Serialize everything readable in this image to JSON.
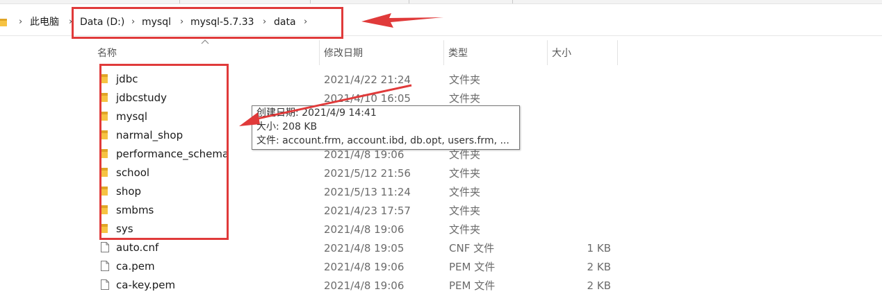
{
  "breadcrumb": {
    "items": [
      "此电脑",
      "Data (D:)",
      "mysql",
      "mysql-5.7.33",
      "data"
    ],
    "separator": "›"
  },
  "columns": [
    "名称",
    "修改日期",
    "类型",
    "大小"
  ],
  "rows": [
    {
      "name": "jdbc",
      "date": "2021/4/22 21:24",
      "type": "文件夹",
      "size": "",
      "kind": "folder"
    },
    {
      "name": "jdbcstudy",
      "date": "2021/4/10 16:05",
      "type": "文件夹",
      "size": "",
      "kind": "folder"
    },
    {
      "name": "mysql",
      "date": "",
      "type": "",
      "size": "",
      "kind": "folder"
    },
    {
      "name": "narmal_shop",
      "date": "",
      "type": "",
      "size": "",
      "kind": "folder"
    },
    {
      "name": "performance_schema",
      "date": "2021/4/8 19:06",
      "type": "文件夹",
      "size": "",
      "kind": "folder"
    },
    {
      "name": "school",
      "date": "2021/5/12 21:56",
      "type": "文件夹",
      "size": "",
      "kind": "folder"
    },
    {
      "name": "shop",
      "date": "2021/5/13 11:24",
      "type": "文件夹",
      "size": "",
      "kind": "folder"
    },
    {
      "name": "smbms",
      "date": "2021/4/23 17:57",
      "type": "文件夹",
      "size": "",
      "kind": "folder"
    },
    {
      "name": "sys",
      "date": "2021/4/8 19:06",
      "type": "文件夹",
      "size": "",
      "kind": "folder"
    },
    {
      "name": "auto.cnf",
      "date": "2021/4/8 19:05",
      "type": "CNF 文件",
      "size": "1 KB",
      "kind": "file"
    },
    {
      "name": "ca.pem",
      "date": "2021/4/8 19:06",
      "type": "PEM 文件",
      "size": "2 KB",
      "kind": "file"
    },
    {
      "name": "ca-key.pem",
      "date": "2021/4/8 19:06",
      "type": "PEM 文件",
      "size": "2 KB",
      "kind": "file"
    }
  ],
  "tooltip": {
    "created": "创建日期: 2021/4/9 14:41",
    "size": "大小: 208 KB",
    "files": "文件: account.frm, account.ibd, db.opt, users.frm, ..."
  },
  "colors": {
    "annotation_red": "#e03a3a",
    "folder_yellow": "#f6c343",
    "folder_dark": "#e0a526"
  },
  "icons": {
    "folder": "folder-icon",
    "file": "file-icon",
    "separator": "chevron-right-icon",
    "sort": "sort-ascending-icon"
  }
}
